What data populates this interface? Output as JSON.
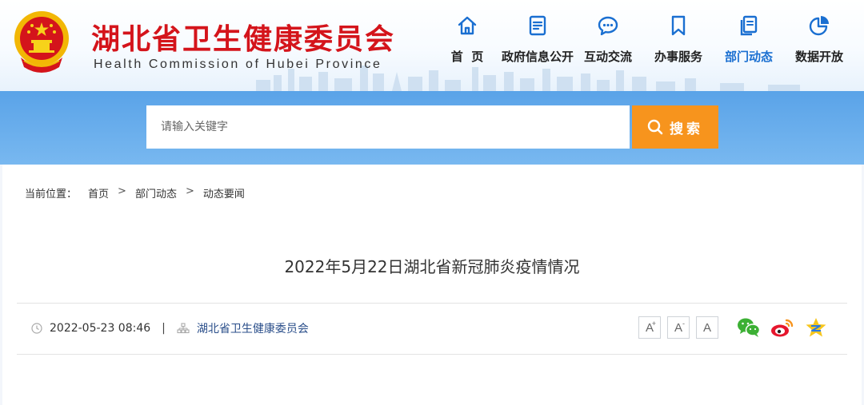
{
  "header": {
    "title": "湖北省卫生健康委员会",
    "subtitle": "Health Commission of Hubei Province",
    "accent": "#d4141b"
  },
  "nav": [
    {
      "label": "首  页",
      "icon": "home-icon"
    },
    {
      "label": "政府信息公开",
      "icon": "document-list-icon"
    },
    {
      "label": "互动交流",
      "icon": "chat-bubble-icon"
    },
    {
      "label": "办事服务",
      "icon": "bookmark-icon"
    },
    {
      "label": "部门动态",
      "icon": "pages-icon",
      "active": true
    },
    {
      "label": "数据开放",
      "icon": "pie-chart-icon"
    }
  ],
  "search": {
    "placeholder": "请输入关键字",
    "button_label": "搜索",
    "button_color": "#f7941d"
  },
  "breadcrumb": {
    "prefix": "当前位置：",
    "items": [
      "首页",
      "部门动态",
      "动态要闻"
    ],
    "separator": ">"
  },
  "article": {
    "title": "2022年5月22日湖北省新冠肺炎疫情情况",
    "date": "2022-05-23 08:46",
    "meta_separator": "|",
    "source": "湖北省卫生健康委员会"
  },
  "font_controls": {
    "increase": "A",
    "increase_mark": "+",
    "decrease": "A",
    "decrease_mark": "-",
    "reset": "A"
  },
  "share": [
    "wechat-icon",
    "weibo-icon",
    "qzone-icon"
  ]
}
